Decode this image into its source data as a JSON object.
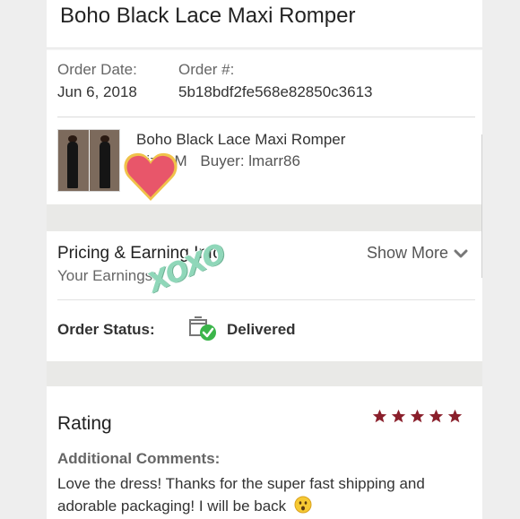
{
  "header": {
    "product_title": "Boho Black Lace Maxi Romper"
  },
  "order": {
    "date_label": "Order Date:",
    "date_value": "Jun 6, 2018",
    "number_label": "Order #:",
    "number_value": "5b18bdf2fe568e82850c3613"
  },
  "item": {
    "name": "Boho Black Lace Maxi Romper",
    "size_label": "Size: M",
    "buyer_label": "Buyer: lmarr86"
  },
  "pricing": {
    "title": "Pricing & Earning Info",
    "earnings_label": "Your Earnings:",
    "show_more": "Show More",
    "chevron_icon": "chevron-down-icon"
  },
  "status": {
    "label": "Order Status:",
    "value": "Delivered",
    "icon": "delivered-box-check-icon",
    "check_color": "#3bb54a"
  },
  "stickers": {
    "xoxo_text": "XOXO",
    "heart_icon": "heart-icon",
    "heart_color": "#e8566a"
  },
  "rating": {
    "title": "Rating",
    "stars": 5,
    "star_color": "#8a1f2b",
    "comments_label": "Additional Comments:",
    "comment": "Love the dress! Thanks for the super fast shipping and adorable packaging! I will be back",
    "emoji_icon": "surprised-face-emoji-icon"
  }
}
